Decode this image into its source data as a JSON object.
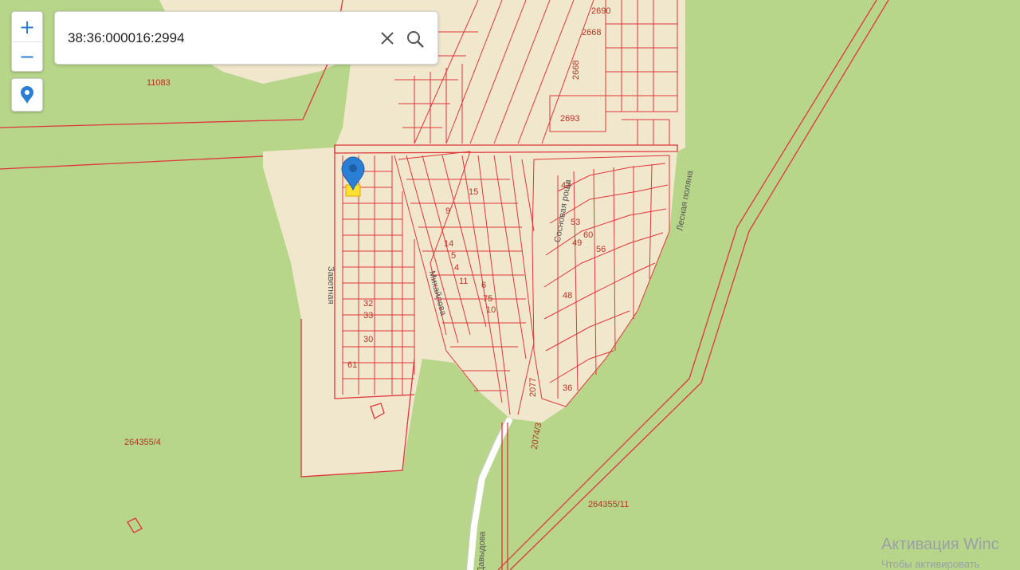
{
  "search": {
    "query": "38:36:000016:2994"
  },
  "zoom": {
    "in_label": "+",
    "out_label": "−"
  },
  "icons": {
    "locate": "map-pin-icon",
    "clear": "close-icon",
    "search": "search-icon",
    "marker": "map-marker-icon"
  },
  "colors": {
    "forest": "#b7d68a",
    "settlement": "#f1e7cd",
    "boundary": "#e0363b",
    "accent": "#2a7fd4",
    "highlight": "#ffe033"
  },
  "map": {
    "parcel_numbers": [
      "2690",
      "2668",
      "2668",
      "2693",
      "11083",
      "264355/4",
      "264355/11",
      "2077",
      "2074/3",
      "43",
      "15",
      "9",
      "14",
      "5",
      "4",
      "11",
      "6",
      "75",
      "10",
      "32",
      "33",
      "30",
      "61",
      "53",
      "60",
      "49",
      "56",
      "48",
      "36"
    ],
    "streets": [
      "Заветная",
      "Сосновая роща",
      "Лесная поляна",
      "Михайлова",
      "Давыдова"
    ],
    "watermark": "Активация Winc",
    "watermark_sub": "Чтобы активировать"
  }
}
